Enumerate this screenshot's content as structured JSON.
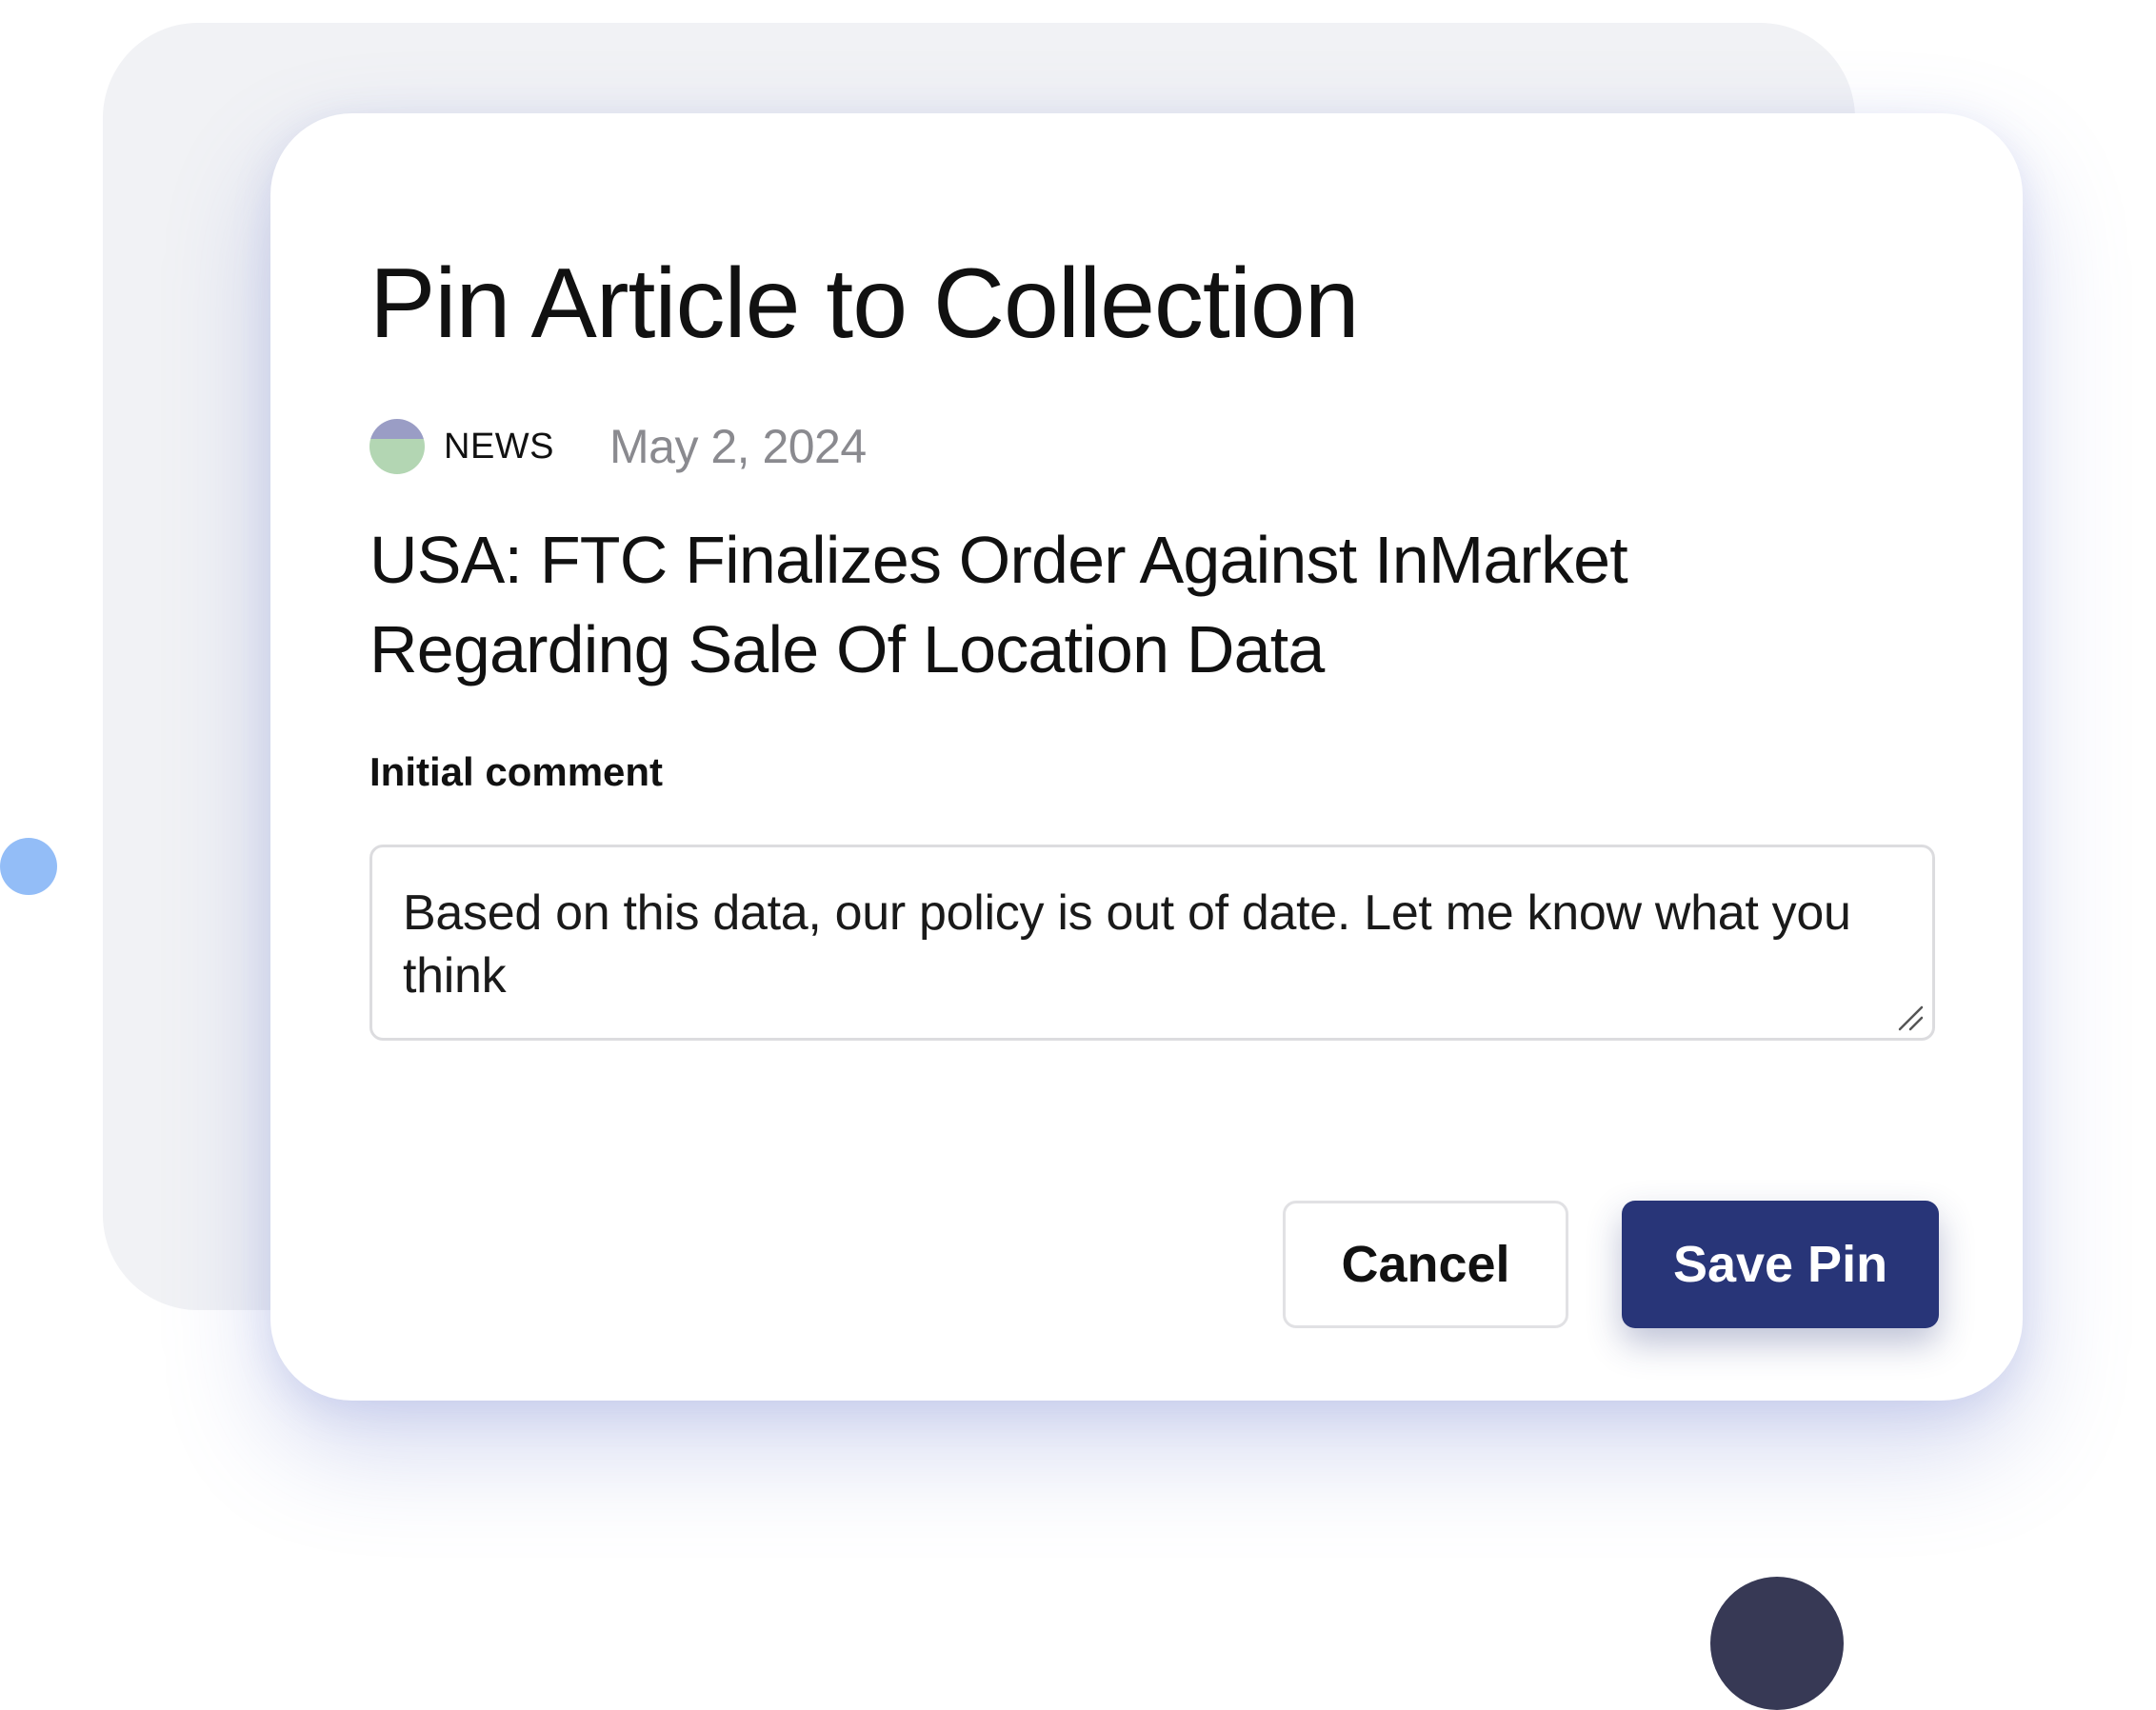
{
  "modal": {
    "title": "Pin Article to Collection",
    "source_label": "NEWS",
    "date": "May 2, 2024",
    "headline": "USA: FTC Finalizes Order Against InMarket Regarding Sale Of Location Data",
    "comment_label": "Initial comment",
    "comment_value": "Based on this data, our policy is out of date. Let me know what you think",
    "cancel_label": "Cancel",
    "save_label": "Save Pin"
  },
  "icons": {
    "source": "news-source-icon",
    "resize": "resize-handle-icon"
  },
  "colors": {
    "primary_button": "#283578",
    "backdrop_card": "#f1f2f5",
    "accent_dot_blue": "#93bdf7",
    "accent_dot_navy": "#373955",
    "date_text": "#8a8a8f"
  }
}
